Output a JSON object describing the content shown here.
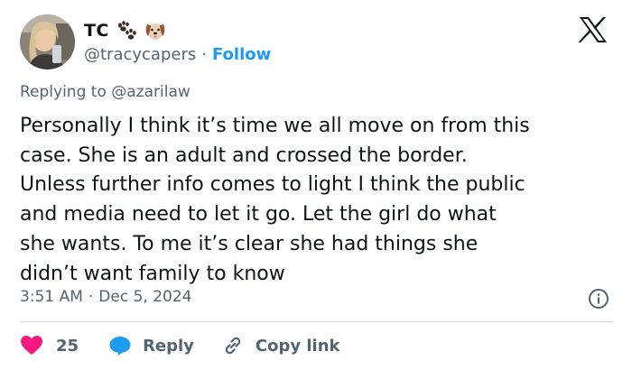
{
  "author": {
    "display_name": "TC",
    "handle": "@tracycapers",
    "follow_label": "Follow",
    "separator": "·",
    "badges": [
      "paw-prints-emoji",
      "dog-face-emoji"
    ]
  },
  "reply_context": {
    "prefix": "Replying to",
    "mention": "@azarilaw"
  },
  "tweet": {
    "lines": [
      "Personally I think it’s time we all move on from this",
      "case. She is an adult and crossed the border.",
      "Unless further info comes to light I think the public",
      "and media need to let it go. Let the girl do what",
      "she wants. To me it’s clear she had things she",
      "didn’t want family to know"
    ],
    "time": "3:51 AM",
    "date": "Dec 5, 2024",
    "separator": "·"
  },
  "actions": {
    "like_count": "25",
    "reply_label": "Reply",
    "copy_link_label": "Copy link"
  },
  "colors": {
    "accent": "#1d9bf0",
    "like": "#f91880",
    "text": "#0f1419",
    "muted": "#536471",
    "divider": "#cfd9de"
  },
  "icons": [
    "x-logo-icon",
    "info-icon",
    "heart-icon",
    "reply-bubble-icon",
    "link-icon"
  ]
}
